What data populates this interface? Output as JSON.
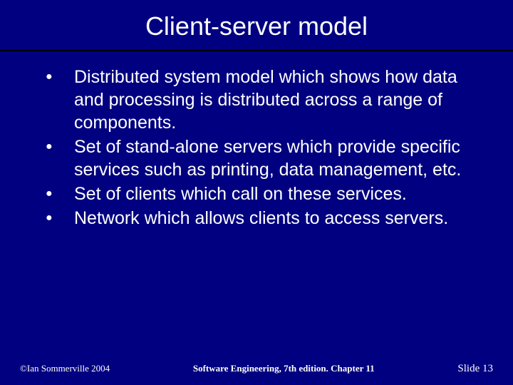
{
  "slide": {
    "title": "Client-server model",
    "bullets": [
      "Distributed system model which shows how data and processing is distributed across a range of components.",
      "Set of stand-alone servers which provide specific services such as printing, data management, etc.",
      "Set of clients which call on these services.",
      "Network which allows clients to access servers."
    ],
    "footer": {
      "left": "©Ian Sommerville 2004",
      "center": "Software Engineering, 7th edition. Chapter 11",
      "right": "Slide 13"
    }
  }
}
